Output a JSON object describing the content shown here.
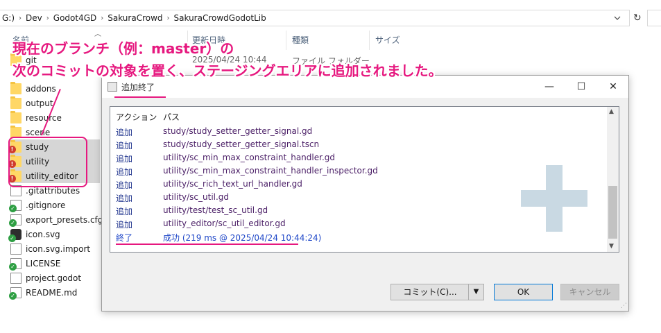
{
  "explorer": {
    "breadcrumb": [
      "G:)",
      "Dev",
      "Godot4GD",
      "SakuraCrowd",
      "SakuraCrowdGodotLib"
    ],
    "columns": {
      "name": "名前",
      "modified": "更新日時",
      "type": "種類",
      "size": "サイズ"
    },
    "partial_row": {
      "name": "git",
      "modified": "2025/04/24 10:44",
      "type": "ファイル フォルダー"
    },
    "files": [
      {
        "name": "addons",
        "icon": "folder-icon"
      },
      {
        "name": "output",
        "icon": "folder-icon"
      },
      {
        "name": "resource",
        "icon": "folder-icon"
      },
      {
        "name": "scene",
        "icon": "folder-icon"
      },
      {
        "name": "study",
        "icon": "conflict-folder-icon"
      },
      {
        "name": "utility",
        "icon": "conflict-folder-icon"
      },
      {
        "name": "utility_editor",
        "icon": "conflict-folder-icon"
      },
      {
        "name": ".gitattributes",
        "icon": "file-icon"
      },
      {
        "name": ".gitignore",
        "icon": "versioned-file-icon"
      },
      {
        "name": "export_presets.cfg",
        "icon": "versioned-file-icon"
      },
      {
        "name": "icon.svg",
        "icon": "godot-svg-icon"
      },
      {
        "name": "icon.svg.import",
        "icon": "file-icon"
      },
      {
        "name": "LICENSE",
        "icon": "versioned-file-icon"
      },
      {
        "name": "project.godot",
        "icon": "file-icon"
      },
      {
        "name": "README.md",
        "icon": "versioned-file-icon"
      }
    ]
  },
  "annotation": {
    "line1": "現在のブランチ（例：master）の",
    "line2": "次のコミットの対象を置く、ステージングエリアに追加されました。"
  },
  "dialog": {
    "title": "追加終了",
    "columns": {
      "action": "アクション",
      "path": "パス"
    },
    "rows": [
      {
        "action": "追加",
        "path": "study/study_setter_getter_signal.gd"
      },
      {
        "action": "追加",
        "path": "study/study_setter_getter_signal.tscn"
      },
      {
        "action": "追加",
        "path": "utility/sc_min_max_constraint_handler.gd"
      },
      {
        "action": "追加",
        "path": "utility/sc_min_max_constraint_handler_inspector.gd"
      },
      {
        "action": "追加",
        "path": "utility/sc_rich_text_url_handler.gd"
      },
      {
        "action": "追加",
        "path": "utility/sc_util.gd"
      },
      {
        "action": "追加",
        "path": "utility/test/test_sc_util.gd"
      },
      {
        "action": "追加",
        "path": "utility_editor/sc_util_editor.gd"
      }
    ],
    "done_row": {
      "action": "終了",
      "path": "成功 (219 ms @ 2025/04/24 10:44:24)"
    },
    "buttons": {
      "commit": "コミット(C)...",
      "ok": "OK",
      "cancel": "キャンセル"
    },
    "window_controls": {
      "minimize": "—",
      "maximize": "☐",
      "close": "✕"
    }
  },
  "colors": {
    "accent_magenta": "#e6187f",
    "action_blue": "#1f47c8"
  }
}
